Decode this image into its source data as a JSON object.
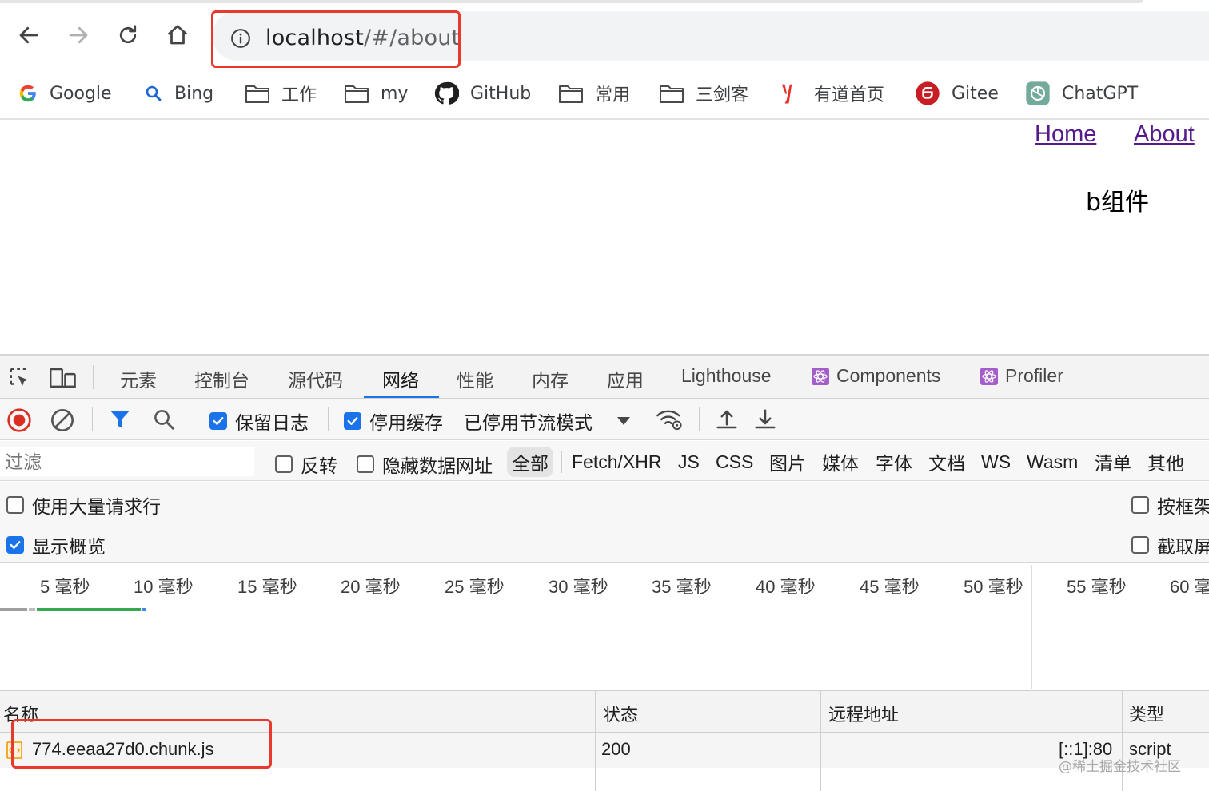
{
  "browser": {
    "url_host": "localhost",
    "url_path": "/#/about",
    "bookmarks": [
      {
        "label": "Google",
        "icon": "google-icon"
      },
      {
        "label": "Bing",
        "icon": "search-icon"
      },
      {
        "label": "工作",
        "icon": "folder-icon"
      },
      {
        "label": "my",
        "icon": "folder-icon"
      },
      {
        "label": "GitHub",
        "icon": "github-icon"
      },
      {
        "label": "常用",
        "icon": "folder-icon"
      },
      {
        "label": "三剑客",
        "icon": "folder-icon"
      },
      {
        "label": "有道首页",
        "icon": "youdao-icon"
      },
      {
        "label": "Gitee",
        "icon": "gitee-icon"
      },
      {
        "label": "ChatGPT",
        "icon": "chatgpt-icon"
      }
    ]
  },
  "page": {
    "nav_links": [
      "Home",
      "About"
    ],
    "component_text": "b组件",
    "link_color": "#551a8b"
  },
  "devtools": {
    "tabs": [
      "元素",
      "控制台",
      "源代码",
      "网络",
      "性能",
      "内存",
      "应用",
      "Lighthouse",
      "Components",
      "Profiler"
    ],
    "active_tab": "网络",
    "toolbar": {
      "preserve_log": "保留日志",
      "disable_cache": "停用缓存",
      "throttling": "已停用节流模式"
    },
    "filter": {
      "placeholder": "过滤",
      "invert": "反转",
      "hide_data_urls": "隐藏数据网址",
      "types": [
        "全部",
        "Fetch/XHR",
        "JS",
        "CSS",
        "图片",
        "媒体",
        "字体",
        "文档",
        "WS",
        "Wasm",
        "清单",
        "其他"
      ],
      "selected_type": "全部"
    },
    "options": {
      "large_rows": "使用大量请求行",
      "group_by_frame": "按框架",
      "show_overview": "显示概览",
      "capture_screenshots": "截取屏"
    },
    "timeline_ticks": [
      "5 毫秒",
      "10 毫秒",
      "15 毫秒",
      "20 毫秒",
      "25 毫秒",
      "30 毫秒",
      "35 毫秒",
      "40 毫秒",
      "45 毫秒",
      "50 毫秒",
      "55 毫秒",
      "60 毫"
    ],
    "table": {
      "columns": [
        "名称",
        "状态",
        "远程地址",
        "类型"
      ],
      "rows": [
        {
          "name": "774.eeaa27d0.chunk.js",
          "status": "200",
          "remote": "[::1]:80",
          "type": "script"
        }
      ]
    },
    "accent_color": "#1a73e8"
  },
  "watermark": "@稀土掘金技术社区",
  "highlight_color": "#e8392c"
}
